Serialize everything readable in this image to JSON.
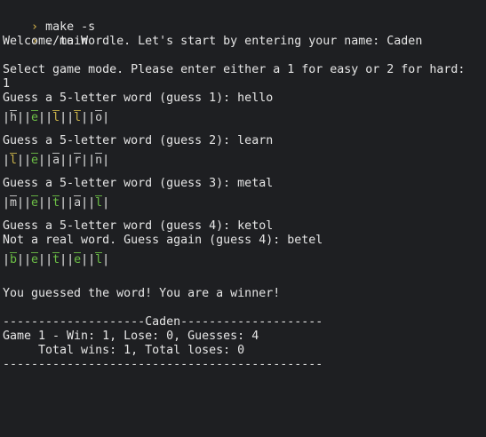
{
  "colors": {
    "background": "#1e1f22",
    "text": "#e6e6e6",
    "prompt": "#d7b44a",
    "green": "#6cbf46",
    "yellow": "#c9b24a",
    "gray": "#d2d2d2"
  },
  "prompt_icon": "chevron-right-icon",
  "commands": [
    {
      "prompt": "›",
      "text": "make -s"
    },
    {
      "prompt": "›",
      "text": "./main"
    }
  ],
  "intro": {
    "welcome": "Welcome to Wordle. Let's start by entering your name: Caden",
    "mode_prompt": "Select game mode. Please enter either a 1 for easy or 2 for hard:",
    "mode_value": "1"
  },
  "guesses": [
    {
      "prompts": [
        "Guess a 5-letter word (guess 1): hello"
      ],
      "tiles": [
        {
          "letter": "h",
          "state": "gray"
        },
        {
          "letter": "e",
          "state": "green"
        },
        {
          "letter": "l",
          "state": "yellow"
        },
        {
          "letter": "l",
          "state": "yellow"
        },
        {
          "letter": "o",
          "state": "gray"
        }
      ]
    },
    {
      "prompts": [
        "Guess a 5-letter word (guess 2): learn"
      ],
      "tiles": [
        {
          "letter": "l",
          "state": "yellow"
        },
        {
          "letter": "e",
          "state": "green"
        },
        {
          "letter": "a",
          "state": "gray"
        },
        {
          "letter": "r",
          "state": "gray"
        },
        {
          "letter": "n",
          "state": "gray"
        }
      ]
    },
    {
      "prompts": [
        "Guess a 5-letter word (guess 3): metal"
      ],
      "tiles": [
        {
          "letter": "m",
          "state": "gray"
        },
        {
          "letter": "e",
          "state": "green"
        },
        {
          "letter": "t",
          "state": "green"
        },
        {
          "letter": "a",
          "state": "gray"
        },
        {
          "letter": "l",
          "state": "green"
        }
      ]
    },
    {
      "prompts": [
        "Guess a 5-letter word (guess 4): ketol",
        "Not a real word. Guess again (guess 4): betel"
      ],
      "tiles": [
        {
          "letter": "b",
          "state": "green"
        },
        {
          "letter": "e",
          "state": "green"
        },
        {
          "letter": "t",
          "state": "green"
        },
        {
          "letter": "e",
          "state": "green"
        },
        {
          "letter": "l",
          "state": "green"
        }
      ]
    }
  ],
  "result": "You guessed the word! You are a winner!",
  "summary": {
    "header": "--------------------Caden--------------------",
    "game_line": "Game 1 - Win: 1, Lose: 0, Guesses: 4",
    "totals_line": "     Total wins: 1, Total loses: 0",
    "footer": "---------------------------------------------"
  }
}
